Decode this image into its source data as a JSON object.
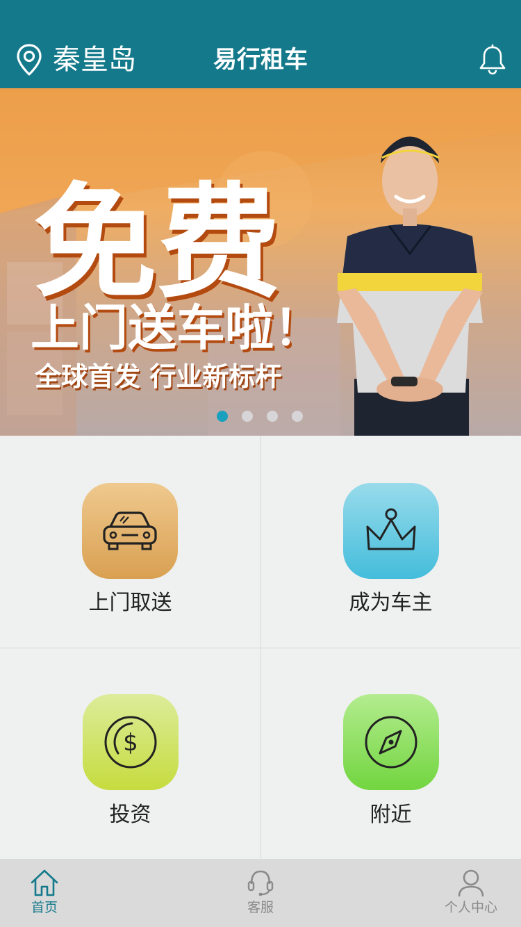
{
  "header": {
    "city": "秦皇岛",
    "app_title": "易行租车"
  },
  "banner": {
    "headline": "免费",
    "subline": "上门送车啦！",
    "slogan": "全球首发  行业新标杆",
    "slide_count": 4,
    "active_slide": 1
  },
  "services": [
    {
      "label": "上门取送",
      "icon": "car-icon"
    },
    {
      "label": "成为车主",
      "icon": "crown-icon"
    },
    {
      "label": "投资",
      "icon": "dollar-coin-icon"
    },
    {
      "label": "附近",
      "icon": "compass-icon"
    }
  ],
  "tabbar": {
    "tabs": [
      {
        "label": "首页",
        "icon": "home-icon",
        "active": true
      },
      {
        "label": "客服",
        "icon": "headset-icon",
        "active": false
      },
      {
        "label": "个人中心",
        "icon": "user-icon",
        "active": false
      }
    ]
  },
  "colors": {
    "brand": "#147a8b",
    "accent": "#1aa0bf",
    "tile_orange": "#e3ac60",
    "tile_blue": "#5bc3de",
    "tile_yellowgreen": "#c7e050",
    "tile_green": "#7dd64f"
  }
}
